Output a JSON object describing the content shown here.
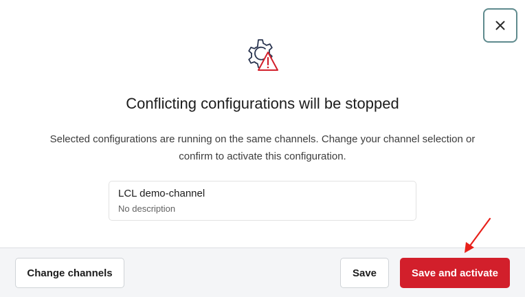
{
  "dialog": {
    "title": "Conflicting configurations will be stopped",
    "description": "Selected configurations are running on the same channels. Change your channel selection or confirm to activate this configuration.",
    "close_icon": "close-icon",
    "hero_icon": "gear-warning-icon"
  },
  "channels": [
    {
      "name": "LCL demo-channel",
      "description": "No description"
    }
  ],
  "footer": {
    "change_channels_label": "Change channels",
    "save_label": "Save",
    "save_activate_label": "Save and activate"
  },
  "colors": {
    "primary": "#d21f2b",
    "close_border": "#5e8a8d",
    "footer_bg": "#f4f5f7",
    "warning": "#d21f2b",
    "annotation_arrow": "#e8201a"
  }
}
